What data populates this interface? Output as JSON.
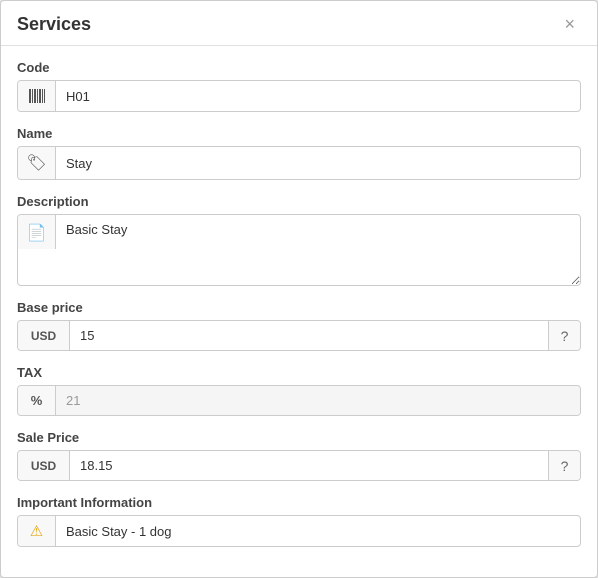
{
  "modal": {
    "title": "Services",
    "close_label": "×"
  },
  "fields": {
    "code": {
      "label": "Code",
      "value": "H01",
      "placeholder": ""
    },
    "name": {
      "label": "Name",
      "value": "Stay",
      "placeholder": ""
    },
    "description": {
      "label": "Description",
      "value": "Basic Stay",
      "placeholder": ""
    },
    "base_price": {
      "label": "Base price",
      "currency": "USD",
      "value": "15",
      "help_icon": "?"
    },
    "tax": {
      "label": "TAX",
      "icon": "%",
      "value": "21",
      "disabled": true
    },
    "sale_price": {
      "label": "Sale Price",
      "currency": "USD",
      "value": "18.15",
      "help_icon": "?"
    },
    "important_info": {
      "label": "Important Information",
      "value": "Basic Stay - 1 dog"
    }
  }
}
